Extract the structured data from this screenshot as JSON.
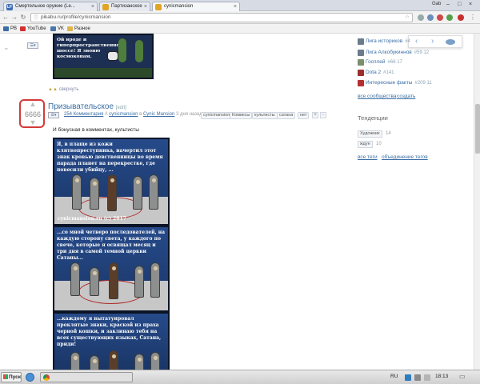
{
  "browser": {
    "tabs": [
      {
        "title": "Смертельное оружие (Le..."
      },
      {
        "title": "Партизанское"
      },
      {
        "title": "cynicmansion"
      }
    ],
    "user_badge": "Gab",
    "url": "pikabu.ru/profile/cynicmansion",
    "bookmarks": [
      {
        "label": "PB",
        "color": "#3a6ea5"
      },
      {
        "label": "YouTube",
        "color": "#d32f2f"
      },
      {
        "label": "VK",
        "color": "#4a76a8"
      },
      {
        "label": "Разное",
        "color": "#e0b24a"
      }
    ]
  },
  "previous_post": {
    "comic_text": "Ой вроде и гиперпространственном шоссе! Я звоню космоконам.",
    "collapse_label": "свернуть"
  },
  "post": {
    "rating": "6666",
    "title": "Призывательское",
    "title_suffix": "[edit]",
    "comments": "254 Комментария",
    "author": "cynicmansion",
    "in_label": "в",
    "community": "Cynic Mansion",
    "time": "3 дня назад",
    "tags": [
      "cynicmansion",
      "Комиксы",
      "культисты",
      "сатана",
      "нет"
    ],
    "intro": "И бонусная в комментах, культисты",
    "panels": [
      {
        "text": "Я, в плаще из кожи клятвопреступника, начертил этот знак кровью девственницы во время парада планет на перекрестке, где повесили убийцу, ...",
        "watermark": "cynicmansion.ru (c) 2017"
      },
      {
        "text": "...со мной четверо последователей, на каждую сторону света, у каждого по свече, которые я освящал месяц и три дня в самой темной церкви Сатаны...",
        "watermark": ""
      },
      {
        "text": "...каждому я вытатуировал проклятые знаки, краской из праха черной кошки, и заклинаю тебя на всех существующих языках, Сатана, приди!",
        "watermark": ""
      }
    ]
  },
  "sidebar": {
    "communities": [
      {
        "name": "Лига историков",
        "count": "#4",
        "color": "#6b7b8c"
      },
      {
        "name": "Лига Алкобукиннов",
        "count": "#59 12",
        "color": "#6b7b8c"
      },
      {
        "name": "Госплей",
        "count": "#66 17",
        "color": "#7b8e6e"
      },
      {
        "name": "Dota 2",
        "count": "#141",
        "color": "#9b2e2e"
      },
      {
        "name": "Интересные факты",
        "count": "#209 11",
        "color": "#b33030"
      }
    ],
    "all_communities": "все сообщества",
    "create": "создать",
    "trends_title": "Тенденции",
    "trends": [
      {
        "tag": "Художник",
        "count": "14"
      },
      {
        "tag": "ждун",
        "count": "10"
      }
    ],
    "all_tags": "все теги",
    "tag_merge": "объединение тегов"
  },
  "taskbar": {
    "start_label": "Пуск",
    "lang": "RU",
    "clock": "18:13"
  }
}
